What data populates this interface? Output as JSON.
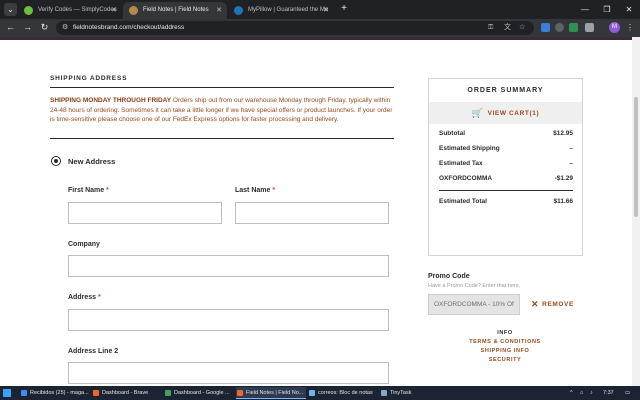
{
  "browser": {
    "tabs": [
      {
        "title": "Verify Codes — SimplyCodes",
        "active": false,
        "color": "#6fbf3b"
      },
      {
        "title": "Field Notes | Field Notes",
        "active": true,
        "color": "#b58a4a"
      },
      {
        "title": "MyPillow | Guaranteed the Mo",
        "active": false,
        "color": "#1f73b7"
      }
    ],
    "url": "fieldnotesbrand.com/checkout/address",
    "profile_initial": "M"
  },
  "checkout": {
    "shipping_heading": "SHIPPING ADDRESS",
    "notice_strong": "SHIPPING MONDAY THROUGH FRIDAY",
    "notice_text": " Orders ship out from our warehouse Monday through Friday, typically within 24-48 hours of ordering. Sometimes it can take a little longer if we have special offers or product launches. If your order is time-sensitive please choose one of our FedEx Express options for faster processing and delivery.",
    "new_address_label": "New Address",
    "fields": {
      "first_name": {
        "label": "First Name",
        "required": "*"
      },
      "last_name": {
        "label": "Last Name",
        "required": "*"
      },
      "company": {
        "label": "Company"
      },
      "address": {
        "label": "Address",
        "required": "*"
      },
      "address2": {
        "label": "Address Line 2"
      }
    }
  },
  "summary": {
    "title": "ORDER SUMMARY",
    "view_cart": "VIEW CART(1)",
    "rows": [
      {
        "label": "Subtotal",
        "value": "$12.95"
      },
      {
        "label": "Estimated Shipping",
        "value": "–"
      },
      {
        "label": "Estimated Tax",
        "value": "–"
      },
      {
        "label": "OXFORDCOMMA",
        "value": "-$1.29"
      }
    ],
    "total": {
      "label": "Estimated Total",
      "value": "$11.66"
    }
  },
  "promo": {
    "title": "Promo Code",
    "hint": "Have a Promo Code? Enter that here.",
    "value": "OXFORDCOMMA - 10% Of",
    "remove_label": "REMOVE"
  },
  "info": {
    "heading": "INFO",
    "links": [
      "TERMS & CONDITIONS",
      "SHIPPING INFO",
      "SECURITY"
    ]
  },
  "taskbar": {
    "items": [
      {
        "label": "Recibidos (25) - maga...",
        "color": "#3c8ef0",
        "active": false
      },
      {
        "label": "Dashboard - Brave",
        "color": "#f0642d",
        "active": false
      },
      {
        "label": "Dashboard - Google ...",
        "color": "#46a15a",
        "active": false
      },
      {
        "label": "Field Notes | Field No...",
        "color": "#f0642d",
        "active": true
      },
      {
        "label": "correos: Bloc de notas",
        "color": "#6fb3e8",
        "active": false
      },
      {
        "label": "TinyTask",
        "color": "#8fa6c2",
        "active": false
      }
    ],
    "time": "7:37"
  }
}
